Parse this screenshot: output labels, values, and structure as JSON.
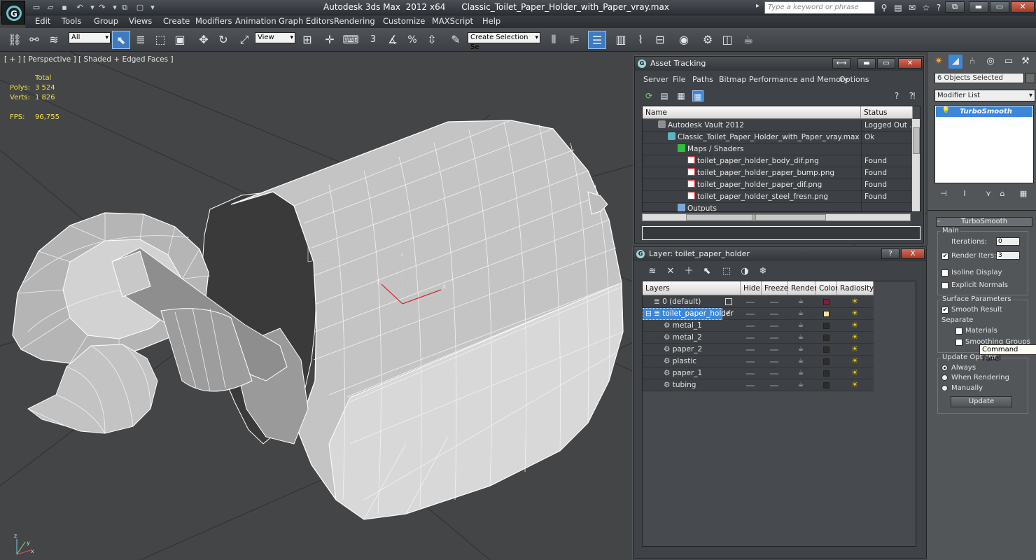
{
  "app": {
    "title": "Autodesk 3ds Max  2012 x64      Classic_Toilet_Paper_Holder_with_Paper_vray.max",
    "search_placeholder": "Type a keyword or phrase"
  },
  "menu": [
    "Edit",
    "Tools",
    "Group",
    "Views",
    "Create",
    "Modifiers",
    "Animation",
    "Graph Editors",
    "Rendering",
    "Customize",
    "MAXScript",
    "Help"
  ],
  "toolbar": {
    "filter_select": "All",
    "refcoord_select": "View",
    "selection_set": "Create Selection Se",
    "snap_3": "3",
    "snap_percent": "%"
  },
  "viewport": {
    "label": "[ + ] [ Perspective ] [ Shaded + Edged Faces ]",
    "stats_header": "Total",
    "polys_label": "Polys:",
    "polys_value": "3 524",
    "verts_label": "Verts:",
    "verts_value": "1 826",
    "fps_label": "FPS:",
    "fps_value": "96,755"
  },
  "command_panel": {
    "object_selection": "6 Objects Selected",
    "modifier_list": "Modifier List",
    "modifier_stack": [
      "TurboSmooth"
    ],
    "rollout_title": "TurboSmooth",
    "main_group": "Main",
    "iterations_label": "Iterations:",
    "iterations_value": "0",
    "render_iters_label": "Render Iters:",
    "render_iters_value": "3",
    "isoline_display": "Isoline Display",
    "explicit_normals": "Explicit Normals",
    "surface_params": "Surface Parameters",
    "smooth_result": "Smooth Result",
    "separate": "Separate",
    "materials": "Materials",
    "smoothing_groups": "Smoothing Groups",
    "update_options": "Update Options",
    "always": "Always",
    "when_rendering": "When Rendering",
    "manually": "Manually",
    "update_button": "Update",
    "tooltip": "Command Panel"
  },
  "asset_tracking": {
    "title": "Asset Tracking",
    "menu": [
      "Server",
      "File",
      "Paths",
      "Bitmap Performance and Memory",
      "Options"
    ],
    "columns": [
      "Name",
      "Status"
    ],
    "rows": [
      {
        "name": "Autodesk Vault 2012",
        "status": "Logged Out ..."
      },
      {
        "name": "Classic_Toilet_Paper_Holder_with_Paper_vray.max",
        "status": "Ok"
      },
      {
        "name": "Maps / Shaders",
        "status": ""
      },
      {
        "name": "toilet_paper_holder_body_dif.png",
        "status": "Found"
      },
      {
        "name": "toilet_paper_holder_paper_bump.png",
        "status": "Found"
      },
      {
        "name": "toilet_paper_holder_paper_dif.png",
        "status": "Found"
      },
      {
        "name": "toilet_paper_holder_steel_fresn.png",
        "status": "Found"
      },
      {
        "name": "Outputs",
        "status": ""
      }
    ],
    "scroll_dots": "|||"
  },
  "layer_window": {
    "title": "Layer: toilet_paper_holder",
    "help_button": "?",
    "close_button": "X",
    "columns": [
      "Layers",
      "Hide",
      "Freeze",
      "Render",
      "Color",
      "Radiosity"
    ],
    "rows": [
      {
        "name": "0 (default)",
        "color": "#8b1a3a"
      },
      {
        "name": "toilet_paper_holder",
        "color": "#f3e4a2"
      },
      {
        "name": "metal_1",
        "color": "#2c2c2c"
      },
      {
        "name": "metal_2",
        "color": "#2c2c2c"
      },
      {
        "name": "paper_2",
        "color": "#2c2c2c"
      },
      {
        "name": "plastic",
        "color": "#2c2c2c"
      },
      {
        "name": "paper_1",
        "color": "#2c2c2c"
      },
      {
        "name": "tubing",
        "color": "#2c2c2c"
      }
    ]
  },
  "colors": {
    "selection_blue": "#3b87d8",
    "stat_yellow": "#f0e048",
    "axis_x": "#d03030",
    "wire": "#ffffff"
  }
}
